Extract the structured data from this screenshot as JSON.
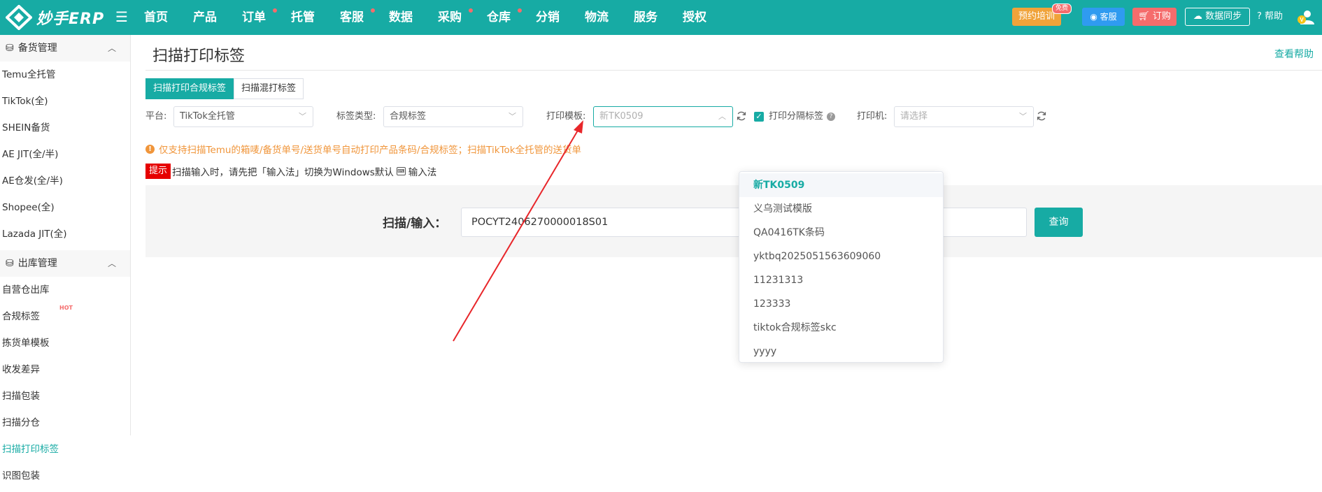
{
  "brand": {
    "name": "妙手ERP"
  },
  "nav": [
    {
      "label": "首页",
      "dot": false
    },
    {
      "label": "产品",
      "dot": false
    },
    {
      "label": "订单",
      "dot": true
    },
    {
      "label": "托管",
      "dot": false
    },
    {
      "label": "客服",
      "dot": true
    },
    {
      "label": "数据",
      "dot": false
    },
    {
      "label": "采购",
      "dot": true
    },
    {
      "label": "仓库",
      "dot": true
    },
    {
      "label": "分销",
      "dot": false
    },
    {
      "label": "物流",
      "dot": false
    },
    {
      "label": "服务",
      "dot": false
    },
    {
      "label": "授权",
      "dot": false
    }
  ],
  "topbar": {
    "training": "预约培训",
    "free_badge": "免费",
    "service": "客服",
    "order": "订购",
    "sync": "数据同步",
    "help": "帮助"
  },
  "sidebar": {
    "group1": {
      "title": "备货管理",
      "items": [
        "Temu全托管",
        "TikTok(全)",
        "SHEIN备货",
        "AE JIT(全/半)",
        "AE仓发(全/半)",
        "Shopee(全)",
        "Lazada JIT(全)"
      ]
    },
    "group2": {
      "title": "出库管理",
      "items": [
        "自营仓出库",
        "合规标签",
        "拣货单模板",
        "收发差异",
        "扫描包装",
        "扫描分仓",
        "扫描打印标签",
        "识图包装"
      ],
      "hot_label": "HOT"
    }
  },
  "page": {
    "title": "扫描打印标签",
    "help_link": "查看帮助",
    "tabs": [
      "扫描打印合规标签",
      "扫描混打标签"
    ]
  },
  "filters": {
    "platform_label": "平台:",
    "platform_value": "TikTok全托管",
    "label_type_label": "标签类型:",
    "label_type_value": "合规标签",
    "template_label": "打印模板:",
    "template_value": "新TK0509",
    "print_separator_label": "打印分隔标签",
    "printer_label": "打印机:",
    "printer_placeholder": "请选择"
  },
  "notice": "仅支持扫描Temu的箱唛/备货单号/送货单号自动打印产品条码/合规标签；扫描TikTok全托管的送货单",
  "tip": {
    "badge": "提示",
    "text_before": "扫描输入时，请先把「输入法」切换为Windows默认",
    "text_after": "输入法"
  },
  "scan": {
    "label": "扫描/输入：",
    "value": "POCYT2406270000018S01",
    "button": "查询"
  },
  "dropdown": {
    "options": [
      "新TK0509",
      "义乌测试模版",
      "QA0416TK条码",
      "yktbq2025051563609060",
      "11231313",
      "123333",
      "tiktok合规标签skc",
      "yyyy"
    ]
  },
  "colors": {
    "primary": "#17aba4",
    "danger": "#f56c6c",
    "warning": "#f0953a"
  }
}
